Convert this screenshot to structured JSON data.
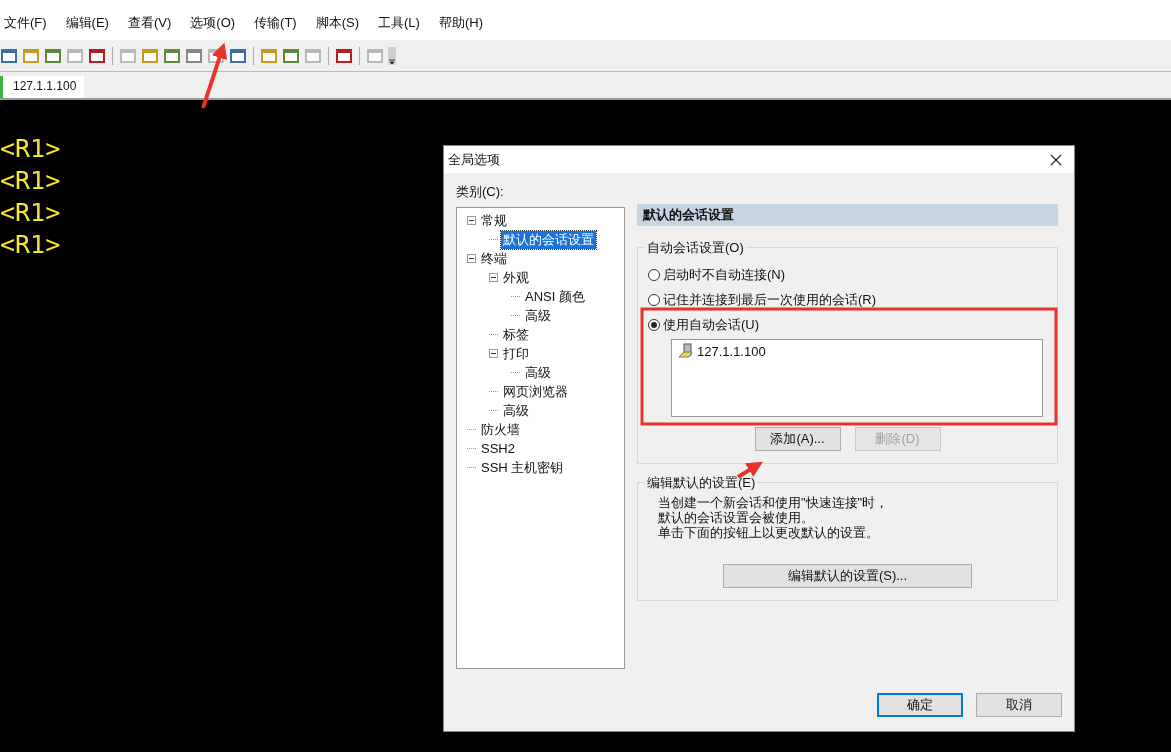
{
  "menu_bar": {
    "items": [
      {
        "label": "文件(F)"
      },
      {
        "label": "编辑(E)"
      },
      {
        "label": "查看(V)"
      },
      {
        "label": "选项(O)"
      },
      {
        "label": "传输(T)"
      },
      {
        "label": "脚本(S)"
      },
      {
        "label": "工具(L)"
      },
      {
        "label": "帮助(H)"
      }
    ]
  },
  "toolbar": {
    "items": [
      {
        "kind": "button",
        "disabled": false
      },
      {
        "kind": "button",
        "disabled": false
      },
      {
        "kind": "button",
        "disabled": false
      },
      {
        "kind": "button",
        "disabled": true
      },
      {
        "kind": "button",
        "disabled": false
      },
      {
        "kind": "separator"
      },
      {
        "kind": "button",
        "disabled": true
      },
      {
        "kind": "button",
        "disabled": false
      },
      {
        "kind": "button",
        "disabled": false
      },
      {
        "kind": "button",
        "disabled": false
      },
      {
        "kind": "button",
        "disabled": true
      },
      {
        "kind": "button",
        "disabled": false
      },
      {
        "kind": "separator"
      },
      {
        "kind": "button",
        "disabled": false
      },
      {
        "kind": "button",
        "disabled": false
      },
      {
        "kind": "button",
        "disabled": true
      },
      {
        "kind": "separator"
      },
      {
        "kind": "button",
        "disabled": false
      },
      {
        "kind": "separator"
      },
      {
        "kind": "button",
        "disabled": true
      },
      {
        "kind": "overflow"
      }
    ]
  },
  "session_tabs": [
    {
      "label": "127.1.1.100",
      "selected": true
    }
  ],
  "terminal": {
    "lines": [
      "<R1>",
      "<R1>",
      "<R1>",
      "<R1>"
    ]
  },
  "dialog": {
    "title": "全局选项",
    "category_label": "类别(C):",
    "tree": [
      {
        "label": "常规",
        "expanded": true,
        "selected": false,
        "children": [
          {
            "label": "默认的会话设置",
            "selected": true
          }
        ]
      },
      {
        "label": "终端",
        "expanded": true,
        "selected": false,
        "children": [
          {
            "label": "外观",
            "expanded": true,
            "selected": false,
            "children": [
              {
                "label": "ANSI 颜色",
                "selected": false
              },
              {
                "label": "高级",
                "selected": false
              }
            ]
          },
          {
            "label": "标签",
            "selected": false
          },
          {
            "label": "打印",
            "expanded": true,
            "selected": false,
            "children": [
              {
                "label": "高级",
                "selected": false
              }
            ]
          },
          {
            "label": "网页浏览器",
            "selected": false
          },
          {
            "label": "高级",
            "selected": false
          }
        ]
      },
      {
        "label": "防火墙",
        "selected": false
      },
      {
        "label": "SSH2",
        "selected": false
      },
      {
        "label": "SSH 主机密钥",
        "selected": false
      }
    ],
    "panel_title": "默认的会话设置",
    "auto_session_group": {
      "legend": "自动会话设置(O)",
      "options": [
        {
          "label": "启动时不自动连接(N)",
          "selected": false
        },
        {
          "label": "记住并连接到最后一次使用的会话(R)",
          "selected": false
        },
        {
          "label": "使用自动会话(U)",
          "selected": true
        }
      ],
      "sessions": [
        {
          "label": "127.1.1.100"
        }
      ],
      "buttons": [
        {
          "label": "添加(A)...",
          "disabled": false
        },
        {
          "label": "删除(D)",
          "disabled": true
        }
      ]
    },
    "edit_defaults_group": {
      "legend": "编辑默认的设置(E)",
      "description": [
        "当创建一个新会话和使用\"快速连接\"时，",
        "默认的会话设置会被使用。",
        "单击下面的按钮上以更改默认的设置。"
      ],
      "button": "编辑默认的设置(S)..."
    },
    "footer_buttons": [
      {
        "label": "确定",
        "default": true
      },
      {
        "label": "取消",
        "default": false
      }
    ]
  }
}
